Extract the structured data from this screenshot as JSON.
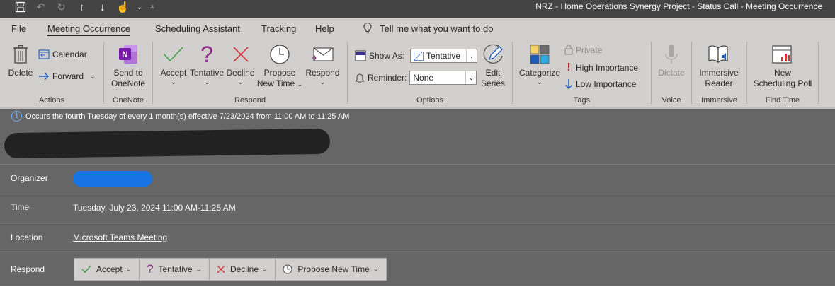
{
  "window_title": "NRZ - Home Operations Synergy Project - Status Call  -  Meeting Occurrence",
  "quick_access": [
    {
      "icon": "save-icon"
    },
    {
      "icon": "undo-icon"
    },
    {
      "icon": "redo-icon"
    },
    {
      "icon": "arrow-up-icon"
    },
    {
      "icon": "arrow-down-icon"
    },
    {
      "icon": "touch-mode-icon"
    },
    {
      "icon": "customize-qat-icon"
    }
  ],
  "menu": {
    "file": "File",
    "meeting_occurrence": "Meeting Occurrence",
    "scheduling_assistant": "Scheduling Assistant",
    "tracking": "Tracking",
    "help": "Help",
    "tell_me": "Tell me what you want to do"
  },
  "ribbon": {
    "actions": {
      "label": "Actions",
      "delete": "Delete",
      "calendar": "Calendar",
      "forward": "Forward"
    },
    "onenote": {
      "label": "OneNote",
      "send_line1": "Send to",
      "send_line2": "OneNote"
    },
    "respond": {
      "label": "Respond",
      "accept": "Accept",
      "tentative": "Tentative",
      "decline": "Decline",
      "propose_line1": "Propose",
      "propose_line2": "New Time",
      "respond": "Respond"
    },
    "options": {
      "label": "Options",
      "show_as_label": "Show As:",
      "show_as_value": "Tentative",
      "reminder_label": "Reminder:",
      "reminder_value": "None",
      "edit_line1": "Edit",
      "edit_line2": "Series"
    },
    "tags": {
      "label": "Tags",
      "categorize": "Categorize",
      "private": "Private",
      "high_importance": "High Importance",
      "low_importance": "Low Importance"
    },
    "voice": {
      "label": "Voice",
      "dictate": "Dictate"
    },
    "immersive": {
      "label": "Immersive",
      "reader_line1": "Immersive",
      "reader_line2": "Reader"
    },
    "find_time": {
      "label": "Find Time",
      "poll_line1": "New",
      "poll_line2": "Scheduling Poll"
    }
  },
  "meeting": {
    "recurrence_info": "Occurs the fourth Tuesday of every 1 month(s) effective 7/23/2024 from 11:00 AM to 11:25 AM",
    "organizer_label": "Organizer",
    "time_label": "Time",
    "time_value": "Tuesday, July 23, 2024 11:00 AM-11:25 AM",
    "location_label": "Location",
    "location_value": "Microsoft Teams Meeting",
    "respond_label": "Respond",
    "respond_buttons": {
      "accept": "Accept",
      "tentative": "Tentative",
      "decline": "Decline",
      "propose": "Propose New Time"
    }
  },
  "colors": {
    "accept_green": "#43a047",
    "tentative_purple": "#8e2b87",
    "decline_red": "#d13438",
    "onenote_purple": "#7719aa",
    "link_blue": "#1674e4"
  }
}
